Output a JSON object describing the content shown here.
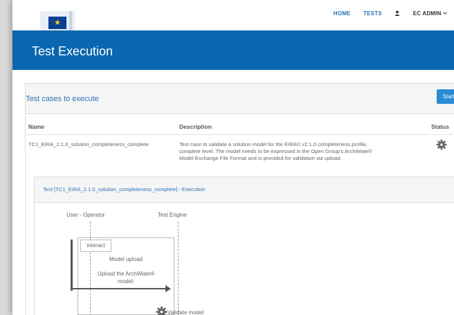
{
  "header": {
    "nav": {
      "home": "HOME",
      "tests": "TESTS",
      "admin": "EC ADMIN"
    },
    "admin_icon": "user-icon",
    "caret_icon": "chevron-down-icon",
    "logo_stars": "★"
  },
  "banner": {
    "title": "Test Execution"
  },
  "panel": {
    "title": "Test cases to execute",
    "start_label": "Start",
    "columns": {
      "name": "Name",
      "description": "Description",
      "status": "Status"
    },
    "row": {
      "name": "TC1_EIRA_2.1.0_solution_completeness_complete",
      "description_lines": [
        "Test case to validate a solution model for the EIRA© v2.1.0 completeness profile,",
        "complete level. The model needs to be expressed in the Open Group's ArchiMate®",
        "Model Exchange File Format and is provided for validation via upload."
      ],
      "status_icon": "gear-icon"
    }
  },
  "execution": {
    "title": "Test [TC1_EIRA_2.1.0_solution_completeness_complete] - Execution",
    "actors": {
      "operator": "User - Operator",
      "engine": "Test Engine"
    },
    "frame_label": "interact",
    "step_title": "Model upload",
    "message_lines": [
      "Upload the ArchiMate®",
      "model:"
    ],
    "validate_label": "Validate model",
    "validate_icon": "gear-icon"
  },
  "colors": {
    "primary": "#0a66ae",
    "link": "#2a73b8",
    "button": "#2a8ad4"
  }
}
